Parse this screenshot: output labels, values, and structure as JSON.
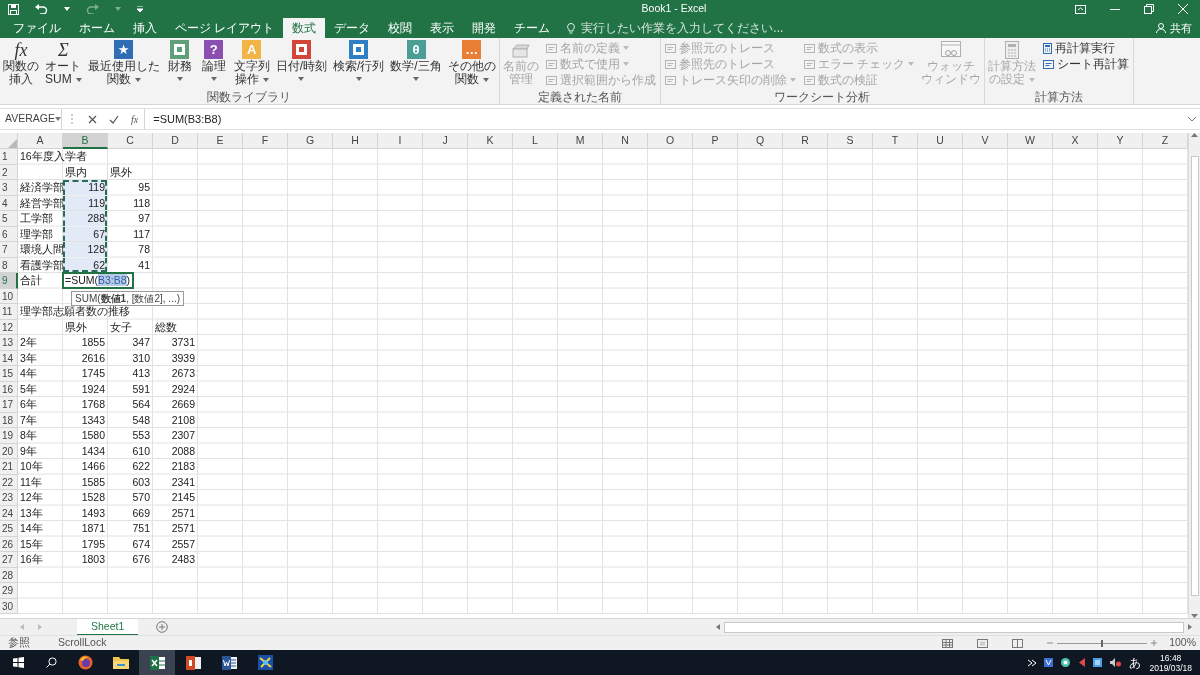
{
  "title_bar": {
    "title": "Book1 - Excel",
    "share": "共有"
  },
  "tabs": [
    {
      "label": "ファイル",
      "selected": false
    },
    {
      "label": "ホーム",
      "selected": false
    },
    {
      "label": "挿入",
      "selected": false
    },
    {
      "label": "ページ レイアウト",
      "selected": false
    },
    {
      "label": "数式",
      "selected": true
    },
    {
      "label": "データ",
      "selected": false
    },
    {
      "label": "校閲",
      "selected": false
    },
    {
      "label": "表示",
      "selected": false
    },
    {
      "label": "開発",
      "selected": false
    },
    {
      "label": "チーム",
      "selected": false
    }
  ],
  "tell_me": {
    "placeholder": "実行したい作業を入力してください..."
  },
  "ribbon_groups": [
    {
      "title": "関数ライブラリ",
      "items": [
        {
          "kind": "symbol",
          "glyph": "fx",
          "lines": [
            "関数の",
            "挿入"
          ],
          "dropdown": false,
          "disabled": false
        },
        {
          "kind": "symbol",
          "glyph": "Σ",
          "lines": [
            "オート",
            "SUM"
          ],
          "dropdown": true,
          "disabled": false
        },
        {
          "kind": "tile",
          "color": "#2f6db5",
          "glyph": "★",
          "lines": [
            "最近使用した",
            "関数"
          ],
          "dropdown": true,
          "disabled": false
        },
        {
          "kind": "tile",
          "color": "#5f9e78",
          "lines": [
            "財務"
          ],
          "dropdown": true,
          "disabled": false
        },
        {
          "kind": "tile",
          "color": "#8a4fb0",
          "glyph": "?",
          "lines": [
            "論理"
          ],
          "dropdown": true,
          "disabled": false
        },
        {
          "kind": "tile",
          "color": "#f1b446",
          "glyph": "A",
          "lines": [
            "文字列",
            "操作"
          ],
          "dropdown": true,
          "disabled": false
        },
        {
          "kind": "tile",
          "color": "#d2463a",
          "lines": [
            "日付/時刻"
          ],
          "dropdown": true,
          "disabled": false
        },
        {
          "kind": "tile",
          "color": "#2f7fc4",
          "lines": [
            "検索/行列"
          ],
          "dropdown": true,
          "disabled": false
        },
        {
          "kind": "tile",
          "color": "#4a9e95",
          "glyph": "θ",
          "lines": [
            "数学/三角"
          ],
          "dropdown": true,
          "disabled": false
        },
        {
          "kind": "tile",
          "color": "#e97f35",
          "glyph": "…",
          "lines": [
            "その他の",
            "関数"
          ],
          "dropdown": true,
          "disabled": false
        }
      ]
    },
    {
      "title": "定義された名前",
      "items": [
        {
          "kind": "tray",
          "lines": [
            "名前の",
            "管理"
          ],
          "dropdown": false,
          "disabled": true
        },
        {
          "kind": "command",
          "label": "名前の定義",
          "dropdown": true,
          "disabled": true
        },
        {
          "kind": "command",
          "label": "数式で使用",
          "dropdown": true,
          "disabled": true
        },
        {
          "kind": "command",
          "label": "選択範囲から作成",
          "dropdown": false,
          "disabled": true
        }
      ]
    },
    {
      "title": "ワークシート分析",
      "items": [
        {
          "kind": "command",
          "label": "参照元のトレース",
          "dropdown": false,
          "disabled": true
        },
        {
          "kind": "command",
          "label": "参照先のトレース",
          "dropdown": false,
          "disabled": true
        },
        {
          "kind": "command",
          "label": "トレース矢印の削除",
          "dropdown": true,
          "disabled": true
        },
        {
          "kind": "command",
          "label": "数式の表示",
          "dropdown": false,
          "disabled": true
        },
        {
          "kind": "command",
          "label": "エラー チェック",
          "dropdown": true,
          "disabled": true
        },
        {
          "kind": "command",
          "label": "数式の検証",
          "dropdown": false,
          "disabled": true
        },
        {
          "kind": "watch",
          "lines": [
            "ウォッチ",
            "ウィンドウ"
          ],
          "dropdown": false,
          "disabled": true
        }
      ]
    },
    {
      "title": "計算方法",
      "items": [
        {
          "kind": "calc",
          "lines": [
            "計算方法",
            "の設定"
          ],
          "dropdown": true,
          "disabled": true
        },
        {
          "kind": "recalc",
          "label": "再計算実行",
          "dropdown": false,
          "disabled": false
        },
        {
          "kind": "command",
          "label": "シート再計算",
          "dropdown": false,
          "disabled": false
        }
      ]
    }
  ],
  "formula_bar": {
    "name_box": "AVERAGE",
    "insert_function": "fx",
    "formula": "=SUM(B3:B8)"
  },
  "sheet": {
    "columns": [
      {
        "label": "A",
        "selected": false
      },
      {
        "label": "B",
        "selected": true
      },
      {
        "label": "C",
        "selected": false
      },
      {
        "label": "D",
        "selected": false
      },
      {
        "label": "E",
        "selected": false
      },
      {
        "label": "F",
        "selected": false
      },
      {
        "label": "G",
        "selected": false
      },
      {
        "label": "H",
        "selected": false
      },
      {
        "label": "I",
        "selected": false
      },
      {
        "label": "J",
        "selected": false
      },
      {
        "label": "K",
        "selected": false
      },
      {
        "label": "L",
        "selected": false
      },
      {
        "label": "M",
        "selected": false
      },
      {
        "label": "N",
        "selected": false
      },
      {
        "label": "O",
        "selected": false
      },
      {
        "label": "P",
        "selected": false
      },
      {
        "label": "Q",
        "selected": false
      },
      {
        "label": "R",
        "selected": false
      },
      {
        "label": "S",
        "selected": false
      },
      {
        "label": "T",
        "selected": false
      },
      {
        "label": "U",
        "selected": false
      },
      {
        "label": "V",
        "selected": false
      },
      {
        "label": "W",
        "selected": false
      },
      {
        "label": "X",
        "selected": false
      },
      {
        "label": "Y",
        "selected": false
      },
      {
        "label": "Z",
        "selected": false
      }
    ],
    "rows": [
      {
        "label": "1",
        "selected": false,
        "cells": [
          {
            "kind": "text",
            "text": "16年度入学者",
            "in_range": false,
            "active": false
          }
        ]
      },
      {
        "label": "2",
        "selected": false,
        "cells": [
          null,
          {
            "kind": "text",
            "text": "県内",
            "in_range": false,
            "active": false
          },
          {
            "kind": "text",
            "text": "県外",
            "in_range": false,
            "active": false
          }
        ]
      },
      {
        "label": "3",
        "selected": false,
        "cells": [
          {
            "kind": "text",
            "text": "経済学部",
            "in_range": false,
            "active": false
          },
          {
            "kind": "number",
            "text": "119",
            "in_range": true,
            "active": false
          },
          {
            "kind": "number",
            "text": "95",
            "in_range": false,
            "active": false
          }
        ]
      },
      {
        "label": "4",
        "selected": false,
        "cells": [
          {
            "kind": "text",
            "text": "経営学部",
            "in_range": false,
            "active": false
          },
          {
            "kind": "number",
            "text": "119",
            "in_range": true,
            "active": false
          },
          {
            "kind": "number",
            "text": "118",
            "in_range": false,
            "active": false
          }
        ]
      },
      {
        "label": "5",
        "selected": false,
        "cells": [
          {
            "kind": "text",
            "text": "工学部",
            "in_range": false,
            "active": false
          },
          {
            "kind": "number",
            "text": "288",
            "in_range": true,
            "active": false
          },
          {
            "kind": "number",
            "text": "97",
            "in_range": false,
            "active": false
          }
        ]
      },
      {
        "label": "6",
        "selected": false,
        "cells": [
          {
            "kind": "text",
            "text": "理学部",
            "in_range": false,
            "active": false
          },
          {
            "kind": "number",
            "text": "67",
            "in_range": true,
            "active": false
          },
          {
            "kind": "number",
            "text": "117",
            "in_range": false,
            "active": false
          }
        ]
      },
      {
        "label": "7",
        "selected": false,
        "cells": [
          {
            "kind": "text",
            "text": "環境人間",
            "in_range": false,
            "active": false
          },
          {
            "kind": "number",
            "text": "128",
            "in_range": true,
            "active": false
          },
          {
            "kind": "number",
            "text": "78",
            "in_range": false,
            "active": false
          }
        ]
      },
      {
        "label": "8",
        "selected": false,
        "cells": [
          {
            "kind": "text",
            "text": "看護学部",
            "in_range": false,
            "active": false
          },
          {
            "kind": "number",
            "text": "62",
            "in_range": true,
            "active": false
          },
          {
            "kind": "number",
            "text": "41",
            "in_range": false,
            "active": false
          }
        ]
      },
      {
        "label": "9",
        "selected": true,
        "cells": [
          {
            "kind": "text",
            "text": "合計",
            "in_range": false,
            "active": false
          },
          {
            "kind": "formula",
            "before": "=SUM(",
            "ref": "B3:B8",
            "after": ")",
            "in_range": false,
            "active": true
          }
        ]
      },
      {
        "label": "10",
        "selected": false
      },
      {
        "label": "11",
        "selected": false,
        "cells": [
          {
            "kind": "text",
            "text": "理学部志願者数の推移",
            "in_range": false,
            "active": false
          }
        ]
      },
      {
        "label": "12",
        "selected": false,
        "cells": [
          null,
          {
            "kind": "text",
            "text": "県外",
            "in_range": false,
            "active": false
          },
          {
            "kind": "text",
            "text": "女子",
            "in_range": false,
            "active": false
          },
          {
            "kind": "text",
            "text": "総数",
            "in_range": false,
            "active": false
          }
        ]
      },
      {
        "label": "13",
        "selected": false,
        "cells": [
          {
            "kind": "text",
            "text": "2年",
            "in_range": false,
            "active": false
          },
          {
            "kind": "number",
            "text": "1855",
            "in_range": false,
            "active": false
          },
          {
            "kind": "number",
            "text": "347",
            "in_range": false,
            "active": false
          },
          {
            "kind": "number",
            "text": "3731",
            "in_range": false,
            "active": false
          }
        ]
      },
      {
        "label": "14",
        "selected": false,
        "cells": [
          {
            "kind": "text",
            "text": "3年",
            "in_range": false,
            "active": false
          },
          {
            "kind": "number",
            "text": "2616",
            "in_range": false,
            "active": false
          },
          {
            "kind": "number",
            "text": "310",
            "in_range": false,
            "active": false
          },
          {
            "kind": "number",
            "text": "3939",
            "in_range": false,
            "active": false
          }
        ]
      },
      {
        "label": "15",
        "selected": false,
        "cells": [
          {
            "kind": "text",
            "text": "4年",
            "in_range": false,
            "active": false
          },
          {
            "kind": "number",
            "text": "1745",
            "in_range": false,
            "active": false
          },
          {
            "kind": "number",
            "text": "413",
            "in_range": false,
            "active": false
          },
          {
            "kind": "number",
            "text": "2673",
            "in_range": false,
            "active": false
          }
        ]
      },
      {
        "label": "16",
        "selected": false,
        "cells": [
          {
            "kind": "text",
            "text": "5年",
            "in_range": false,
            "active": false
          },
          {
            "kind": "number",
            "text": "1924",
            "in_range": false,
            "active": false
          },
          {
            "kind": "number",
            "text": "591",
            "in_range": false,
            "active": false
          },
          {
            "kind": "number",
            "text": "2924",
            "in_range": false,
            "active": false
          }
        ]
      },
      {
        "label": "17",
        "selected": false,
        "cells": [
          {
            "kind": "text",
            "text": "6年",
            "in_range": false,
            "active": false
          },
          {
            "kind": "number",
            "text": "1768",
            "in_range": false,
            "active": false
          },
          {
            "kind": "number",
            "text": "564",
            "in_range": false,
            "active": false
          },
          {
            "kind": "number",
            "text": "2669",
            "in_range": false,
            "active": false
          }
        ]
      },
      {
        "label": "18",
        "selected": false,
        "cells": [
          {
            "kind": "text",
            "text": "7年",
            "in_range": false,
            "active": false
          },
          {
            "kind": "number",
            "text": "1343",
            "in_range": false,
            "active": false
          },
          {
            "kind": "number",
            "text": "548",
            "in_range": false,
            "active": false
          },
          {
            "kind": "number",
            "text": "2108",
            "in_range": false,
            "active": false
          }
        ]
      },
      {
        "label": "19",
        "selected": false,
        "cells": [
          {
            "kind": "text",
            "text": "8年",
            "in_range": false,
            "active": false
          },
          {
            "kind": "number",
            "text": "1580",
            "in_range": false,
            "active": false
          },
          {
            "kind": "number",
            "text": "553",
            "in_range": false,
            "active": false
          },
          {
            "kind": "number",
            "text": "2307",
            "in_range": false,
            "active": false
          }
        ]
      },
      {
        "label": "20",
        "selected": false,
        "cells": [
          {
            "kind": "text",
            "text": "9年",
            "in_range": false,
            "active": false
          },
          {
            "kind": "number",
            "text": "1434",
            "in_range": false,
            "active": false
          },
          {
            "kind": "number",
            "text": "610",
            "in_range": false,
            "active": false
          },
          {
            "kind": "number",
            "text": "2088",
            "in_range": false,
            "active": false
          }
        ]
      },
      {
        "label": "21",
        "selected": false,
        "cells": [
          {
            "kind": "text",
            "text": "10年",
            "in_range": false,
            "active": false
          },
          {
            "kind": "number",
            "text": "1466",
            "in_range": false,
            "active": false
          },
          {
            "kind": "number",
            "text": "622",
            "in_range": false,
            "active": false
          },
          {
            "kind": "number",
            "text": "2183",
            "in_range": false,
            "active": false
          }
        ]
      },
      {
        "label": "22",
        "selected": false,
        "cells": [
          {
            "kind": "text",
            "text": "11年",
            "in_range": false,
            "active": false
          },
          {
            "kind": "number",
            "text": "1585",
            "in_range": false,
            "active": false
          },
          {
            "kind": "number",
            "text": "603",
            "in_range": false,
            "active": false
          },
          {
            "kind": "number",
            "text": "2341",
            "in_range": false,
            "active": false
          }
        ]
      },
      {
        "label": "23",
        "selected": false,
        "cells": [
          {
            "kind": "text",
            "text": "12年",
            "in_range": false,
            "active": false
          },
          {
            "kind": "number",
            "text": "1528",
            "in_range": false,
            "active": false
          },
          {
            "kind": "number",
            "text": "570",
            "in_range": false,
            "active": false
          },
          {
            "kind": "number",
            "text": "2145",
            "in_range": false,
            "active": false
          }
        ]
      },
      {
        "label": "24",
        "selected": false,
        "cells": [
          {
            "kind": "text",
            "text": "13年",
            "in_range": false,
            "active": false
          },
          {
            "kind": "number",
            "text": "1493",
            "in_range": false,
            "active": false
          },
          {
            "kind": "number",
            "text": "669",
            "in_range": false,
            "active": false
          },
          {
            "kind": "number",
            "text": "2571",
            "in_range": false,
            "active": false
          }
        ]
      },
      {
        "label": "25",
        "selected": false,
        "cells": [
          {
            "kind": "text",
            "text": "14年",
            "in_range": false,
            "active": false
          },
          {
            "kind": "number",
            "text": "1871",
            "in_range": false,
            "active": false
          },
          {
            "kind": "number",
            "text": "751",
            "in_range": false,
            "active": false
          },
          {
            "kind": "number",
            "text": "2571",
            "in_range": false,
            "active": false
          }
        ]
      },
      {
        "label": "26",
        "selected": false,
        "cells": [
          {
            "kind": "text",
            "text": "15年",
            "in_range": false,
            "active": false
          },
          {
            "kind": "number",
            "text": "1795",
            "in_range": false,
            "active": false
          },
          {
            "kind": "number",
            "text": "674",
            "in_range": false,
            "active": false
          },
          {
            "kind": "number",
            "text": "2557",
            "in_range": false,
            "active": false
          }
        ]
      },
      {
        "label": "27",
        "selected": false,
        "cells": [
          {
            "kind": "text",
            "text": "16年",
            "in_range": false,
            "active": false
          },
          {
            "kind": "number",
            "text": "1803",
            "in_range": false,
            "active": false
          },
          {
            "kind": "number",
            "text": "676",
            "in_range": false,
            "active": false
          },
          {
            "kind": "number",
            "text": "2483",
            "in_range": false,
            "active": false
          }
        ]
      },
      {
        "label": "28",
        "selected": false
      },
      {
        "label": "29",
        "selected": false
      },
      {
        "label": "30",
        "selected": false
      }
    ],
    "function_tooltip": "SUM(**数値1**, [数値2], ...)"
  },
  "sheet_tabs": [
    {
      "label": "Sheet1",
      "selected": true
    }
  ],
  "status_bar": {
    "mode": "参照",
    "scroll_lock": "ScrollLock",
    "zoom": "100%",
    "zoom_slider": {
      "level": 0.5
    }
  },
  "taskbar": {
    "apps": [
      {
        "kind": "browser",
        "selected": false
      },
      {
        "kind": "folder",
        "selected": false
      },
      {
        "kind": "spreadsheet",
        "selected": true
      },
      {
        "kind": "presentation",
        "selected": false
      },
      {
        "kind": "document",
        "selected": false
      },
      {
        "kind": "app",
        "selected": false
      }
    ],
    "ime": "あ",
    "time": "16:48",
    "date": "2019/03/18"
  }
}
